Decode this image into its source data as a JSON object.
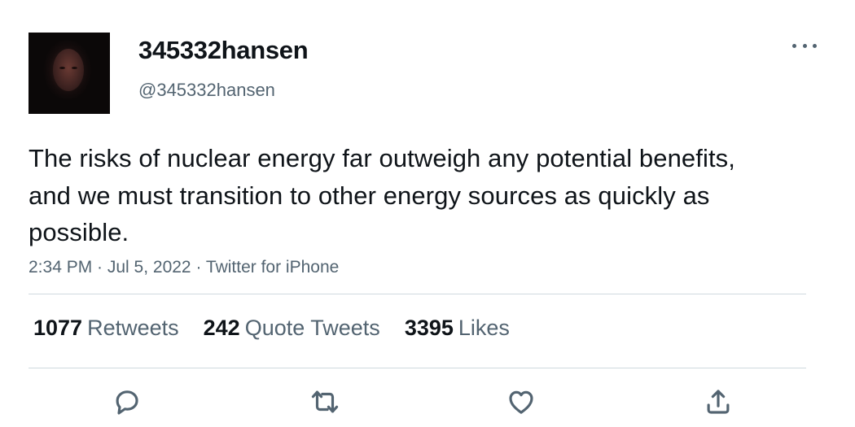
{
  "author": {
    "display_name": "345332hansen",
    "handle": "@345332hansen"
  },
  "tweet": {
    "text": "The risks of nuclear energy far outweigh any potential benefits, and we must transition to other energy sources as quickly as possible.",
    "meta": "2:34 PM · Jul 5, 2022 · Twitter for iPhone"
  },
  "stats": {
    "retweets_count": "1077",
    "retweets_label": "Retweets",
    "quotes_count": "242",
    "quotes_label": "Quote Tweets",
    "likes_count": "3395",
    "likes_label": "Likes"
  },
  "actions": [
    "reply-icon",
    "retweet-icon",
    "like-icon",
    "share-icon"
  ],
  "colors": {
    "text_primary": "#0f1419",
    "text_secondary": "#536471",
    "divider": "#cfd9de"
  }
}
